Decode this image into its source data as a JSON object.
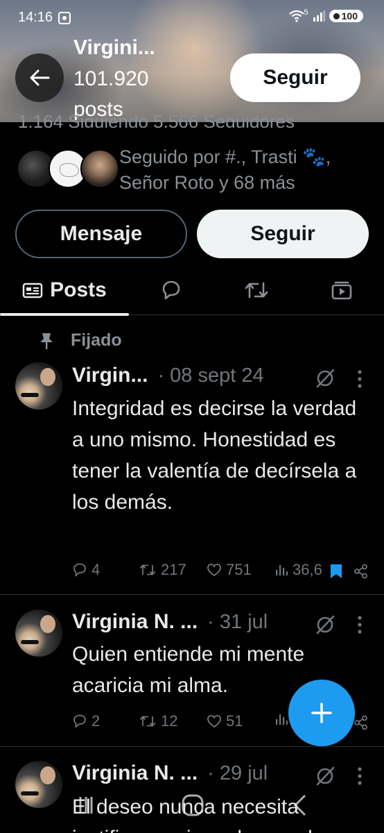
{
  "status_bar": {
    "time": "14:16",
    "network_label": "5",
    "battery": "100"
  },
  "header": {
    "name": "Virgini...",
    "post_count": "101.920 posts",
    "follow_label": "Seguir"
  },
  "profile": {
    "followed_by": "Seguido por #., Trasti 🐾, Señor Roto y 68 más",
    "message_label": "Mensaje",
    "follow_label": "Seguir",
    "stats_partial": "1.164 Siguiendo  5.566 Seguidores"
  },
  "tabs": {
    "posts_label": "Posts"
  },
  "pinned_label": "Fijado",
  "posts": [
    {
      "author": "Virgin...",
      "date": "· 08 sept 24",
      "text": "Integridad es decirse la verdad a uno mismo. Honestidad es tener la valentía de decírsela a los demás.",
      "replies": "4",
      "reposts": "217",
      "likes": "751",
      "views": "36,6"
    },
    {
      "author": "Virginia N. ...",
      "date": "· 31 jul",
      "text": "Quien entiende mi mente acaricia mi alma.",
      "replies": "2",
      "reposts": "12",
      "likes": "51",
      "views": ""
    },
    {
      "author": "Virginia N. ...",
      "date": "· 29 jul",
      "text": "El deseo nunca necesita justificarse sin embargo el",
      "replies": "",
      "reposts": "",
      "likes": "",
      "views": ""
    }
  ],
  "icons": {
    "back": "arrow-left-icon",
    "pin": "pin-icon",
    "grok": "grok-icon",
    "more": "more-vertical-icon",
    "reply": "reply-icon",
    "repost": "repost-icon",
    "like": "heart-icon",
    "views": "views-icon",
    "bookmark": "bookmark-icon",
    "share": "share-icon",
    "compose": "plus-icon"
  },
  "colors": {
    "accent": "#1d9bf0",
    "background": "#000000",
    "muted": "#71767b",
    "text": "#e7e9ea"
  }
}
